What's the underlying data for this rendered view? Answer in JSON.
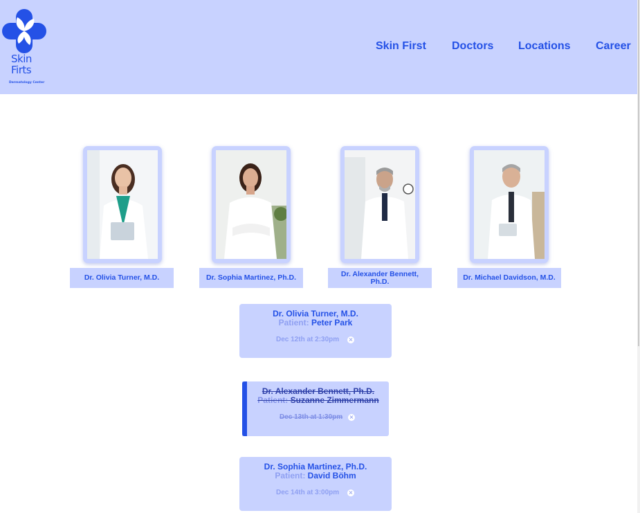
{
  "brand": {
    "logo_line1": "Skin",
    "logo_line2": "Firts",
    "tagline": "Dermatology Center",
    "color": "#2451e6",
    "bg": "#c8d2ff"
  },
  "nav": {
    "items": [
      {
        "label": "Skin First"
      },
      {
        "label": "Doctors"
      },
      {
        "label": "Locations"
      },
      {
        "label": "Career"
      }
    ]
  },
  "doctors": [
    {
      "name": "Dr. Olivia Turner, M.D.",
      "icon": "doctor-photo"
    },
    {
      "name": "Dr. Sophia Martinez, Ph.D.",
      "icon": "doctor-photo"
    },
    {
      "name": "Dr. Alexander Bennett, Ph.D.",
      "icon": "doctor-photo"
    },
    {
      "name": "Dr. Michael Davidson, M.D.",
      "icon": "doctor-photo"
    }
  ],
  "appointments": [
    {
      "doctor": "Dr. Olivia Turner, M.D.",
      "patient_label": "Patient:",
      "patient": "Peter Park",
      "when": "Dec 12th at 2:30pm",
      "cancelled": false
    },
    {
      "doctor": "Dr. Alexander Bennett, Ph.D.",
      "patient_label": "Patient:",
      "patient": "Suzanne Zimmermann",
      "when": "Dec 13th at 1:30pm",
      "cancelled": true
    },
    {
      "doctor": "Dr. Sophia Martinez, Ph.D.",
      "patient_label": "Patient:",
      "patient": "David Böhm",
      "when": "Dec 14th at 3:00pm",
      "cancelled": false
    }
  ],
  "icons": {
    "remove": "×"
  }
}
